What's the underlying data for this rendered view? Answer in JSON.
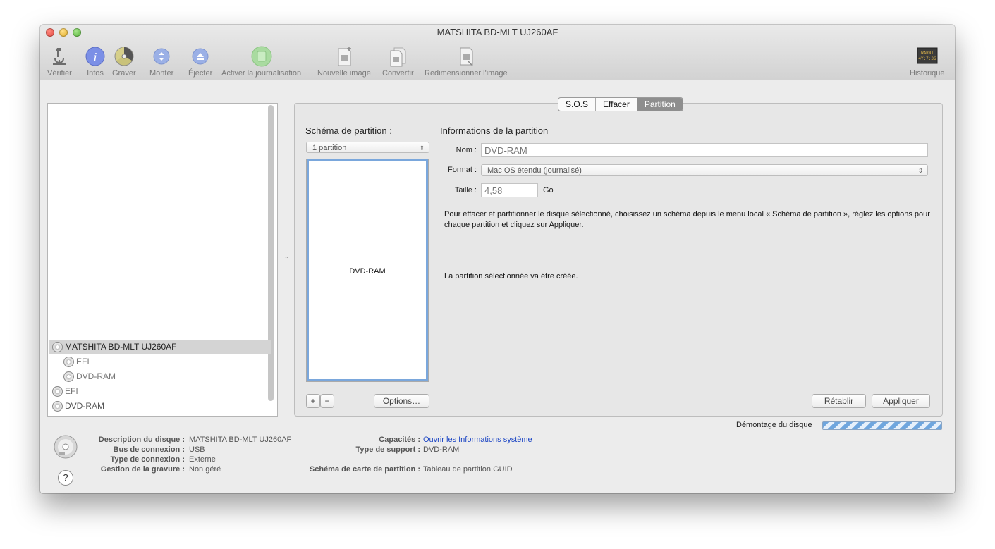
{
  "window": {
    "title": "MATSHITA BD-MLT UJ260AF"
  },
  "toolbar": {
    "verify": "Vérifier",
    "info": "Infos",
    "burn": "Graver",
    "mount": "Monter",
    "eject": "Éjecter",
    "journaling": "Activer la journalisation",
    "new_image": "Nouvelle image",
    "convert": "Convertir",
    "resize": "Redimensionner l'image",
    "log": "Historique",
    "log_icon_text": "WARNI\n4Y:7:36"
  },
  "sidebar": {
    "items": [
      {
        "label": "MATSHITA BD-MLT UJ260AF"
      },
      {
        "label": "EFI"
      },
      {
        "label": "DVD-RAM"
      },
      {
        "label": "EFI"
      },
      {
        "label": "DVD-RAM"
      }
    ]
  },
  "tabs": {
    "sos": "S.O.S",
    "erase": "Effacer",
    "partition": "Partition"
  },
  "partition": {
    "scheme_title": "Schéma de partition :",
    "scheme_value": "1 partition",
    "box_name": "DVD-RAM",
    "options_label": "Options…",
    "add_label": "+",
    "remove_label": "−",
    "info_title": "Informations de la partition",
    "name_label": "Nom :",
    "name_value": "DVD-RAM",
    "format_label": "Format :",
    "format_value": "Mac OS étendu (journalisé)",
    "size_label": "Taille :",
    "size_value": "4,58",
    "size_unit": "Go",
    "help_text": "Pour effacer et partitionner le disque sélectionné, choisissez un schéma depuis le menu local « Schéma de partition », réglez les options pour chaque partition et cliquez sur Appliquer.",
    "status_text": "La partition sélectionnée va être créée.",
    "revert_label": "Rétablir",
    "apply_label": "Appliquer"
  },
  "status": {
    "unmount_label": "Démontage du disque"
  },
  "disk_info": {
    "description_label": "Description du disque :",
    "description_value": "MATSHITA BD-MLT UJ260AF",
    "bus_label": "Bus de connexion :",
    "bus_value": "USB",
    "conn_type_label": "Type de connexion :",
    "conn_type_value": "Externe",
    "burn_mgmt_label": "Gestion de la gravure :",
    "burn_mgmt_value": "Non géré",
    "capabilities_label": "Capacités :",
    "capabilities_value": "Ouvrir les Informations système",
    "media_type_label": "Type de support :",
    "media_type_value": "DVD-RAM",
    "partition_map_label": "Schéma de carte de partition :",
    "partition_map_value": "Tableau de partition GUID"
  },
  "help_button": "?",
  "colors": {
    "accent": "#7aa7dc",
    "link": "#1a44c4",
    "tab_active": "#8e8e8e"
  }
}
